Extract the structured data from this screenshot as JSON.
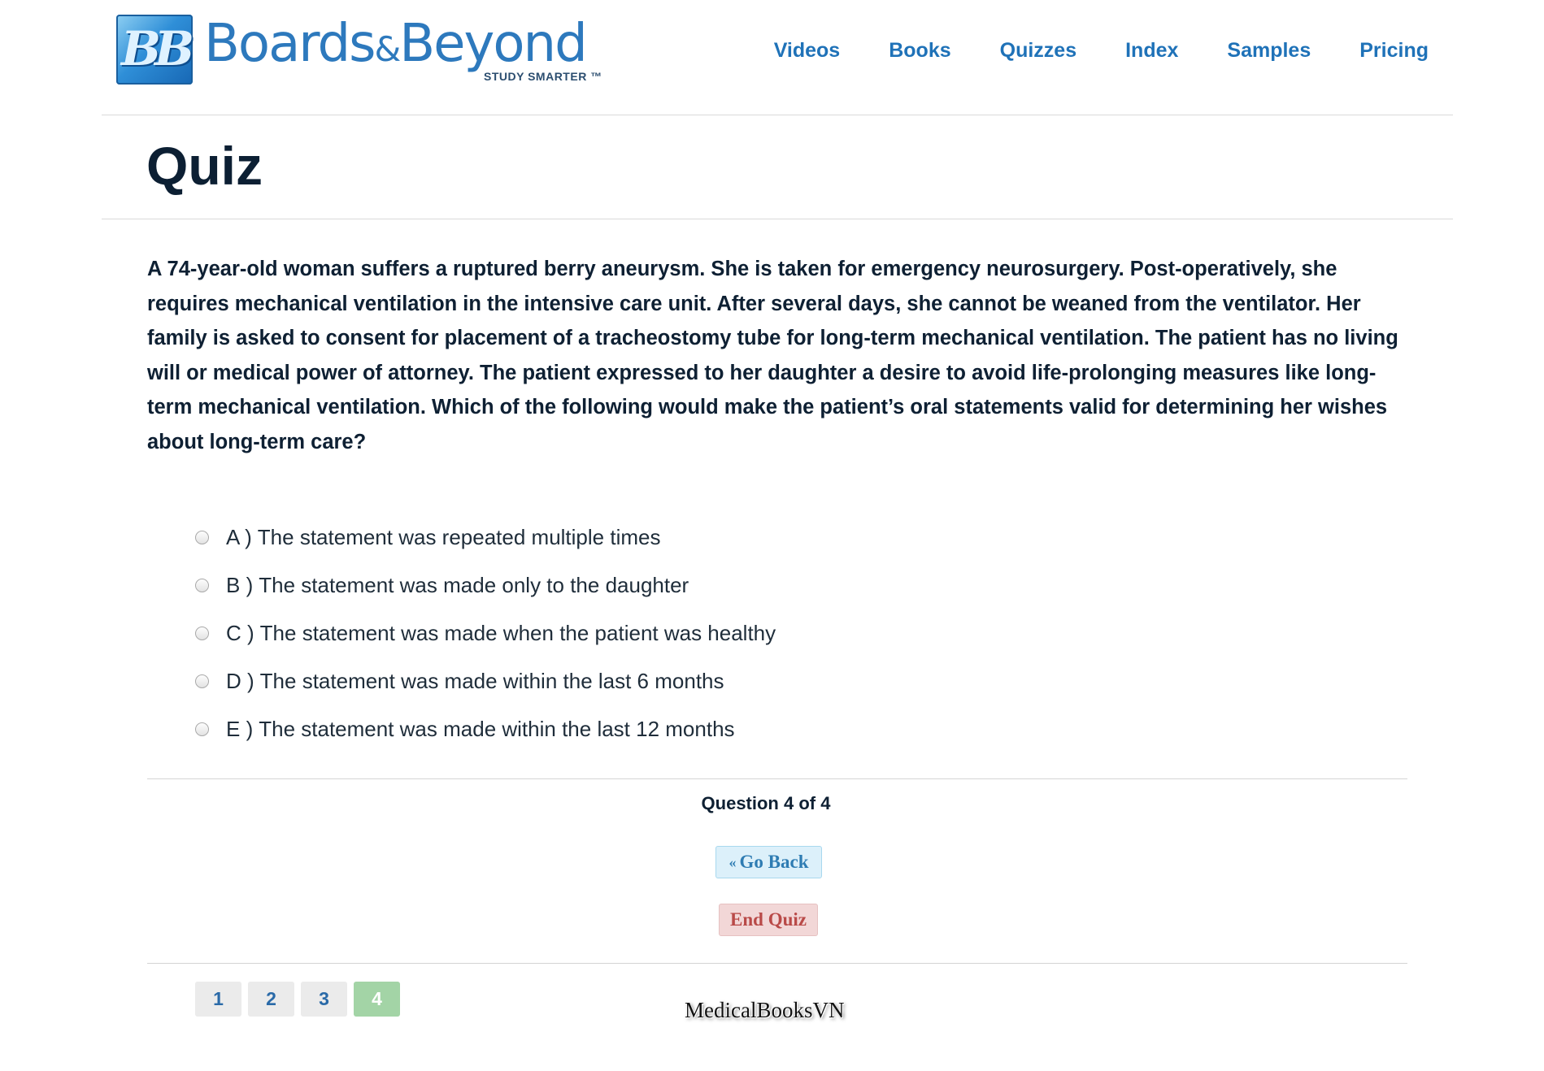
{
  "header": {
    "logo": {
      "mark": "BB",
      "word_left": "Boards",
      "amp": "&",
      "word_right": "Beyond",
      "tagline": "STUDY SMARTER ™"
    },
    "nav": [
      "Videos",
      "Books",
      "Quizzes",
      "Index",
      "Samples",
      "Pricing"
    ]
  },
  "page_title": "Quiz",
  "question": {
    "text": "A 74-year-old woman suffers a ruptured berry aneurysm. She is taken for emergency neurosurgery. Post-operatively, she requires mechanical ventilation in the intensive care unit. After several days, she cannot be weaned from the ventilator. Her family is asked to consent for placement of a tracheostomy tube for long-term mechanical ventilation. The patient has no living will or medical power of attorney. The patient expressed to her daughter a desire to avoid life-prolonging measures like long-term mechanical ventilation. Which of the following would make the patient’s oral statements valid for determining her wishes about long-term care?",
    "options": [
      {
        "letter": "A )",
        "text": "The statement was repeated multiple times"
      },
      {
        "letter": "B )",
        "text": "The statement was made only to the daughter"
      },
      {
        "letter": "C )",
        "text": "The statement was made when the patient was healthy"
      },
      {
        "letter": "D )",
        "text": "The statement was made within the last 6 months"
      },
      {
        "letter": "E )",
        "text": "The statement was made within the last 12 months"
      }
    ]
  },
  "progress": {
    "label": "Question 4 of 4"
  },
  "buttons": {
    "back_prefix": "«",
    "back": "Go Back",
    "end": "End Quiz"
  },
  "pager": {
    "pages": [
      "1",
      "2",
      "3",
      "4"
    ],
    "current": "4",
    "current_color": "#a3d4a6"
  },
  "watermark": "MedicalBooksVN",
  "colors": {
    "brand_blue": "#1f72b8",
    "back_button_bg": "#dcf0fa",
    "end_button_bg": "#f2d7d7",
    "end_button_text": "#b94a48"
  }
}
